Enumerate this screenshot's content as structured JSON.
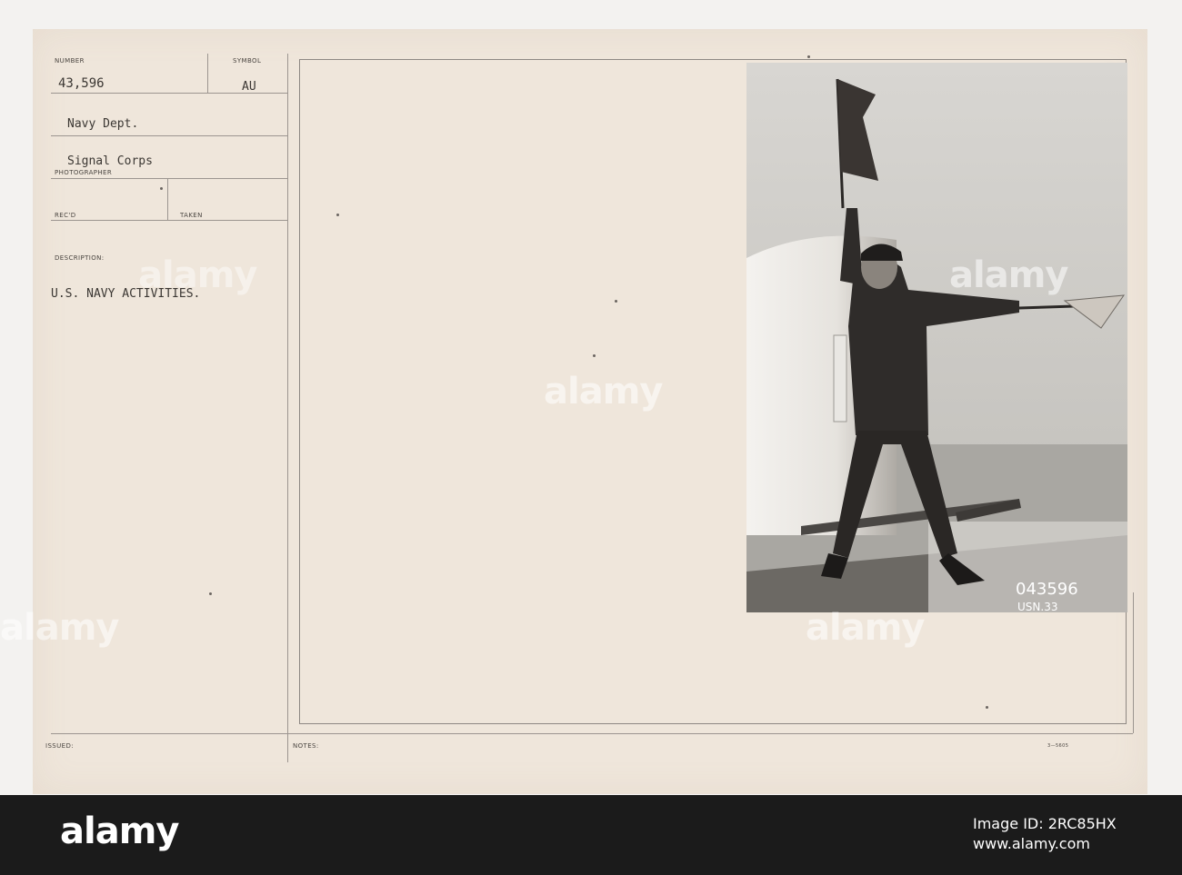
{
  "card": {
    "number_label": "NUMBER",
    "number_value": "43,596",
    "symbol_label": "SYMBOL",
    "symbol_value": "AU",
    "agency": "Navy Dept.",
    "photographer_value": "Signal Corps",
    "photographer_label": "PHOTOGRAPHER",
    "recd_label": "REC'D",
    "taken_label": "TAKEN",
    "description_label": "DESCRIPTION:",
    "description_value": "U.S. NAVY ACTIVITIES.",
    "issued_label": "ISSUED:",
    "notes_label": "NOTES:",
    "form_code": "3—5605"
  },
  "photo": {
    "caption_line1": "043596",
    "caption_line2": "USN.33"
  },
  "stock": {
    "watermark_text": "alamy",
    "logo_text": "alamy",
    "image_id_line": "Image ID: 2RC85HX",
    "url_line": "www.alamy.com"
  }
}
